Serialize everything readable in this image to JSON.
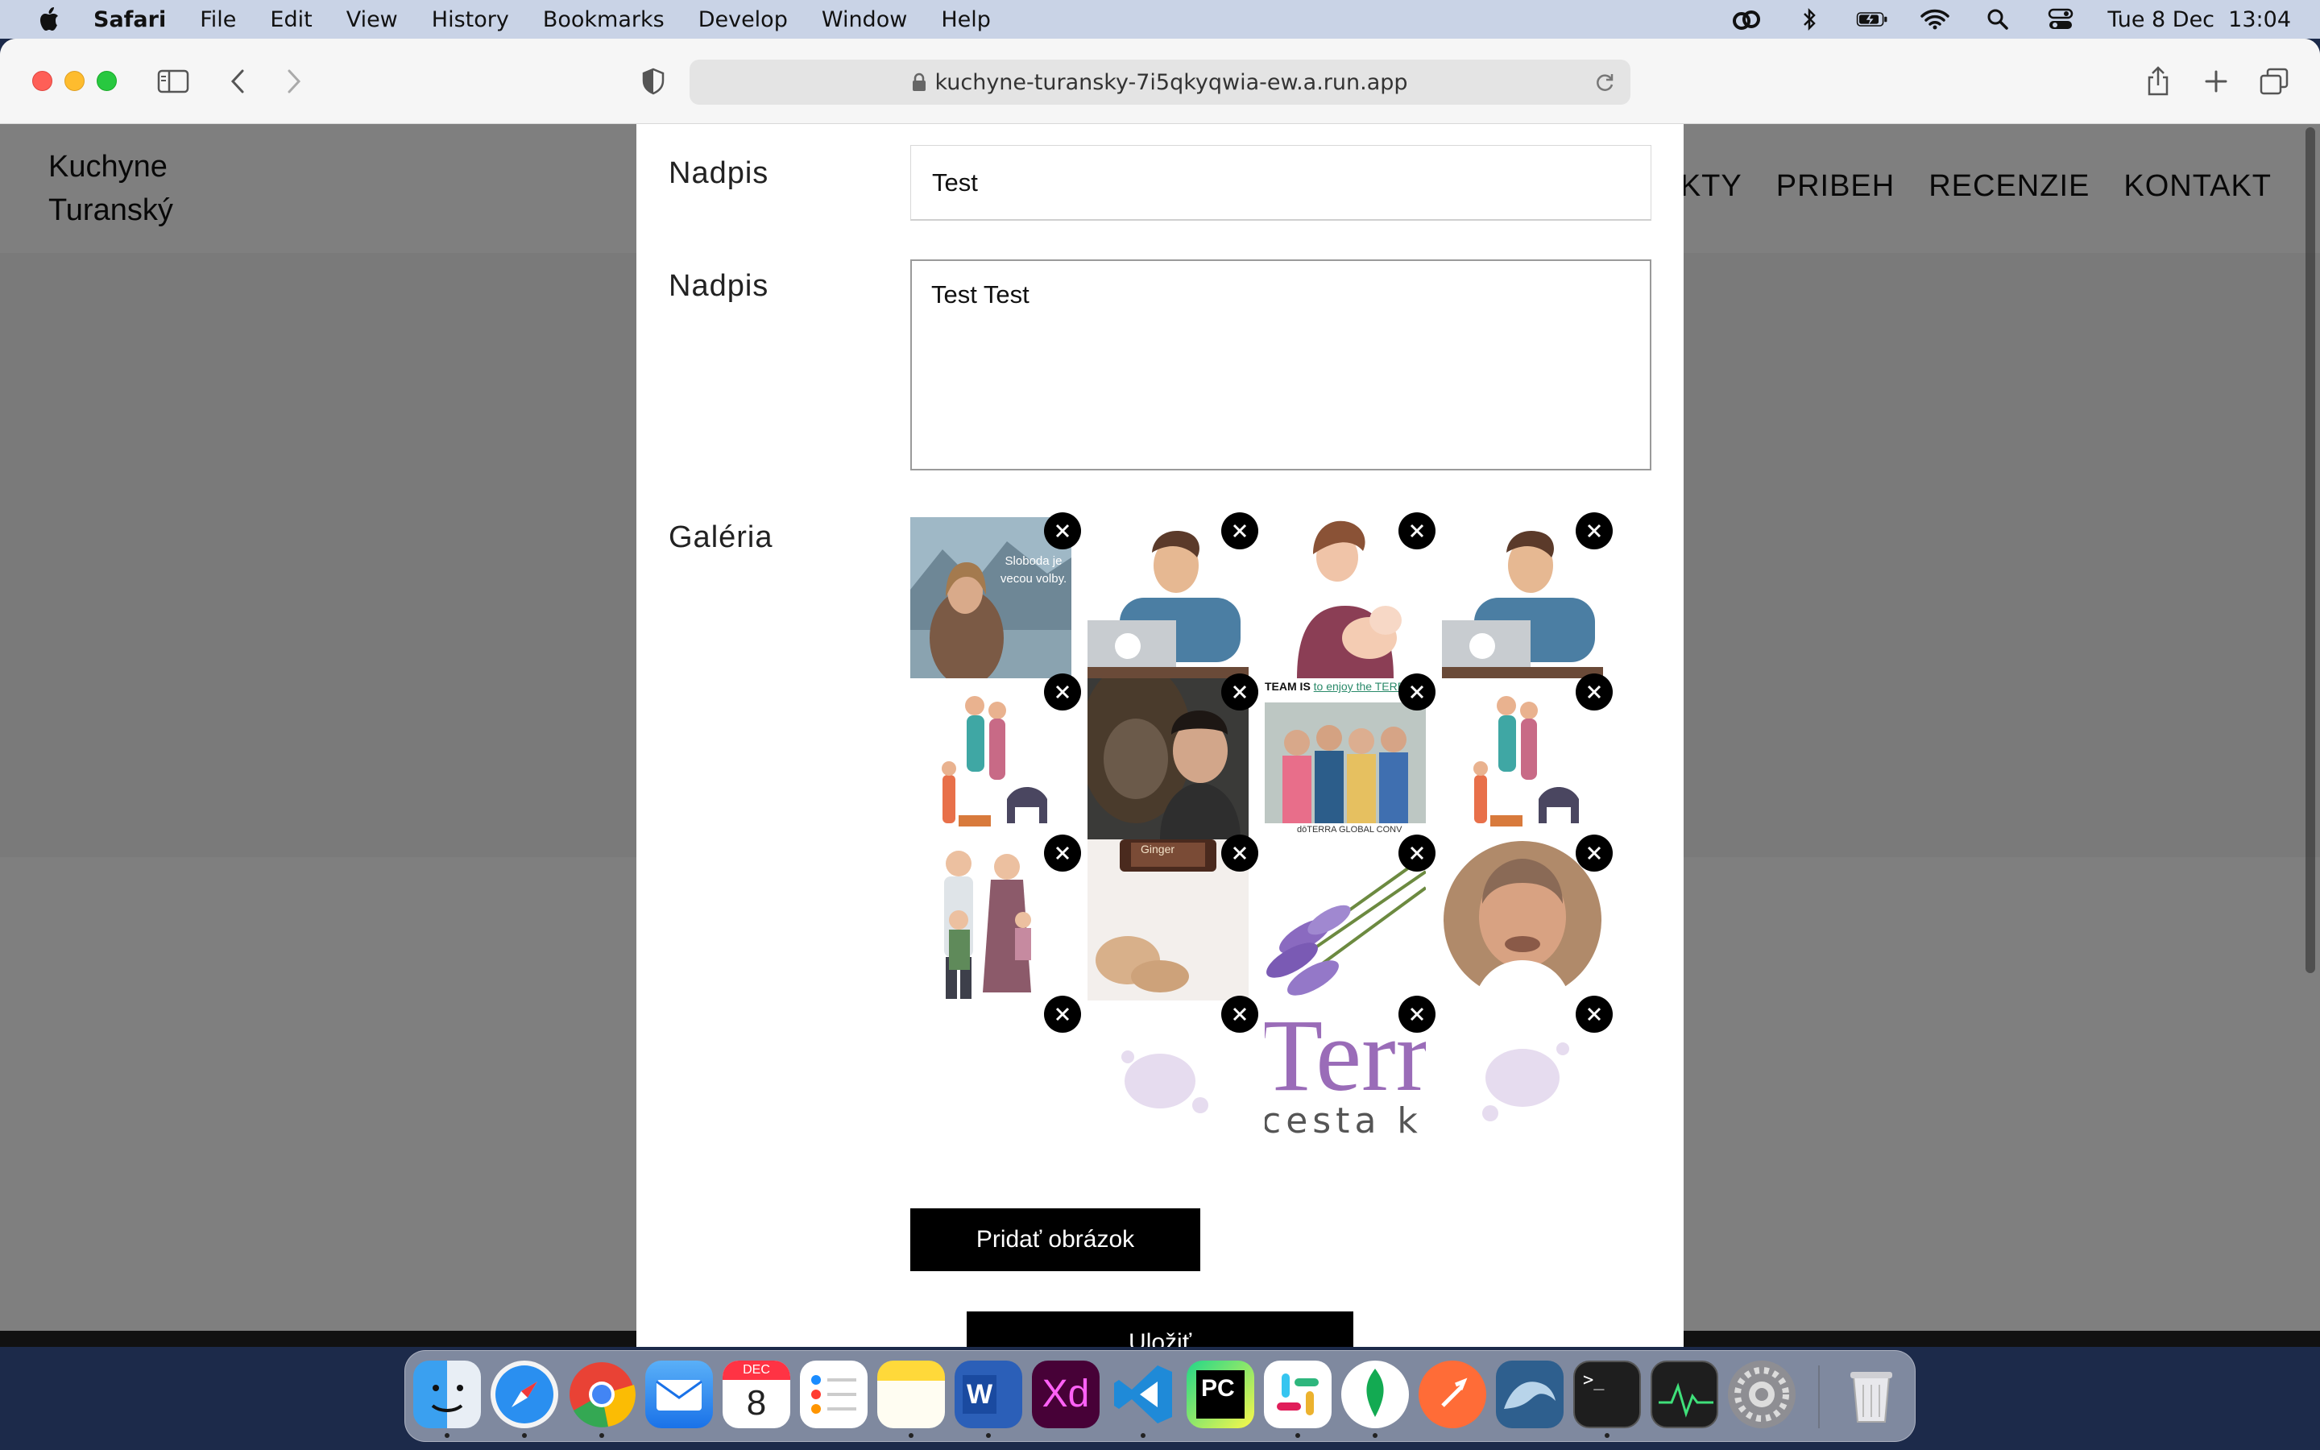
{
  "menubar": {
    "app_name": "Safari",
    "items": [
      "File",
      "Edit",
      "View",
      "History",
      "Bookmarks",
      "Develop",
      "Window",
      "Help"
    ],
    "clock": "Tue 8 Dec  13:04",
    "status_icons": [
      "creative-cloud-icon",
      "bluetooth-icon",
      "battery-icon",
      "wifi-icon",
      "spotlight-icon",
      "control-center-icon"
    ]
  },
  "browser": {
    "url": "kuchyne-turansky-7i5qkyqwia-ew.a.run.app"
  },
  "site": {
    "logo_line1": "Kuchyne",
    "logo_line2": "Turanský",
    "nav": [
      "KTY",
      "PRIBEH",
      "RECENZIE",
      "KONTAKT"
    ]
  },
  "modal": {
    "title_label": "Nadpis",
    "title_value": "Test",
    "text_label": "Nadpis",
    "text_value": "Test Test",
    "gallery_label": "Galéria",
    "gallery_items": [
      {
        "name": "woman-lake-photo",
        "caption_line1": "Sloboda je",
        "caption_line2": "vecou volby."
      },
      {
        "name": "man-laptop-illustration"
      },
      {
        "name": "mother-baby-illustration"
      },
      {
        "name": "man-laptop-illustration-2"
      },
      {
        "name": "family-dog-illustration"
      },
      {
        "name": "women-smiling-photo"
      },
      {
        "name": "team-doterra-photo",
        "banner_text": "TEAM IS",
        "banner_link": "to enjoy the TERRA",
        "footer_text": "dōTERRA GLOBAL CONV"
      },
      {
        "name": "family-dog-illustration-2"
      },
      {
        "name": "family-portrait-illustration"
      },
      {
        "name": "ginger-oil-photo",
        "bottle_label": "Ginger"
      },
      {
        "name": "lavender-photo"
      },
      {
        "name": "man-portrait-photo"
      },
      {
        "name": "empty-slot"
      },
      {
        "name": "splash-logo-left"
      },
      {
        "name": "terra-logo",
        "logo_text": "Terra",
        "logo_sub": "cesta k"
      },
      {
        "name": "splash-logo-right"
      }
    ],
    "add_image_label": "Pridať obrázok",
    "save_label": "Uložiť"
  },
  "dock": {
    "apps": [
      "Finder",
      "Safari",
      "Chrome",
      "Mail",
      "Calendar",
      "Reminders",
      "Notes",
      "Word",
      "Adobe XD",
      "VS Code",
      "PyCharm",
      "Slack",
      "MongoDB Compass",
      "Postman",
      "MySQL Workbench",
      "Terminal",
      "Activity Monitor",
      "System Preferences",
      "Trash"
    ],
    "calendar_month": "DEC",
    "calendar_day": "8",
    "xd_label": "Xd",
    "pc_label": "PC",
    "word_label": "W",
    "terminal_prompt": ">_"
  },
  "colors": {
    "menubar": "#c9d3e6",
    "overlay": "rgba(0,0,0,0.5)",
    "button": "#000000",
    "desktop": "#1c2a4a"
  }
}
